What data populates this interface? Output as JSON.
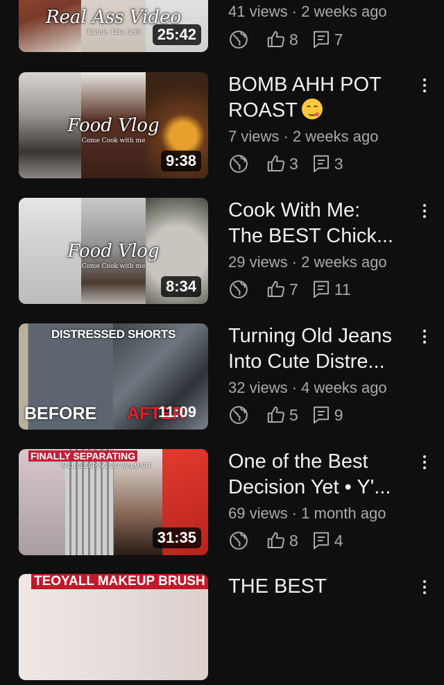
{
  "videos": [
    {
      "overlay_title": "Real Ass Video",
      "overlay_sub": "Tiktok: Tilia Grill",
      "duration": "25:42",
      "title_lines": [],
      "meta": "41 views · 2 weeks ago",
      "likes": "8",
      "comments": "7"
    },
    {
      "overlay_title": "Food Vlog",
      "overlay_sub": "Come Cook with me",
      "duration": "9:38",
      "title_lines": [
        "BOMB AHH POT",
        "ROAST"
      ],
      "title_emoji": "yum-face-emoji",
      "meta": "7 views · 2 weeks ago",
      "likes": "3",
      "comments": "3"
    },
    {
      "overlay_title": "Food Vlog",
      "overlay_sub": "Come Cook with me",
      "duration": "8:34",
      "title_lines": [
        "Cook With Me:",
        "The BEST Chick..."
      ],
      "meta": "29 views · 2 weeks ago",
      "likes": "7",
      "comments": "11"
    },
    {
      "overlay_title": "DISTRESSED SHORTS",
      "overlay_left": "BEFORE",
      "overlay_right": "AFTER",
      "duration": "11:09",
      "title_lines": [
        "Turning Old Jeans",
        "Into Cute Distre..."
      ],
      "meta": "32 views · 4 weeks ago",
      "likes": "5",
      "comments": "9"
    },
    {
      "overlay_title": "FINALLY SEPARATING",
      "overlay_sub": "YALL SLEEPING ON WALMART",
      "duration": "31:35",
      "title_lines": [
        "One of the Best",
        "Decision Yet • Y'..."
      ],
      "meta": "69 views · 1 month ago",
      "likes": "8",
      "comments": "4"
    },
    {
      "overlay_title": "TEOYALL MAKEUP BRUSH",
      "title_lines": [
        "THE BEST"
      ]
    }
  ],
  "icons": {
    "visibility": "globe-icon",
    "likes": "thumbs-up-icon",
    "comments": "comment-icon",
    "menu": "more-vert-icon"
  },
  "colors": {
    "background": "#0f0f0f",
    "primary_text": "#f1f1f1",
    "secondary_text": "#aaaaaa",
    "duration_bg": "#000000"
  }
}
